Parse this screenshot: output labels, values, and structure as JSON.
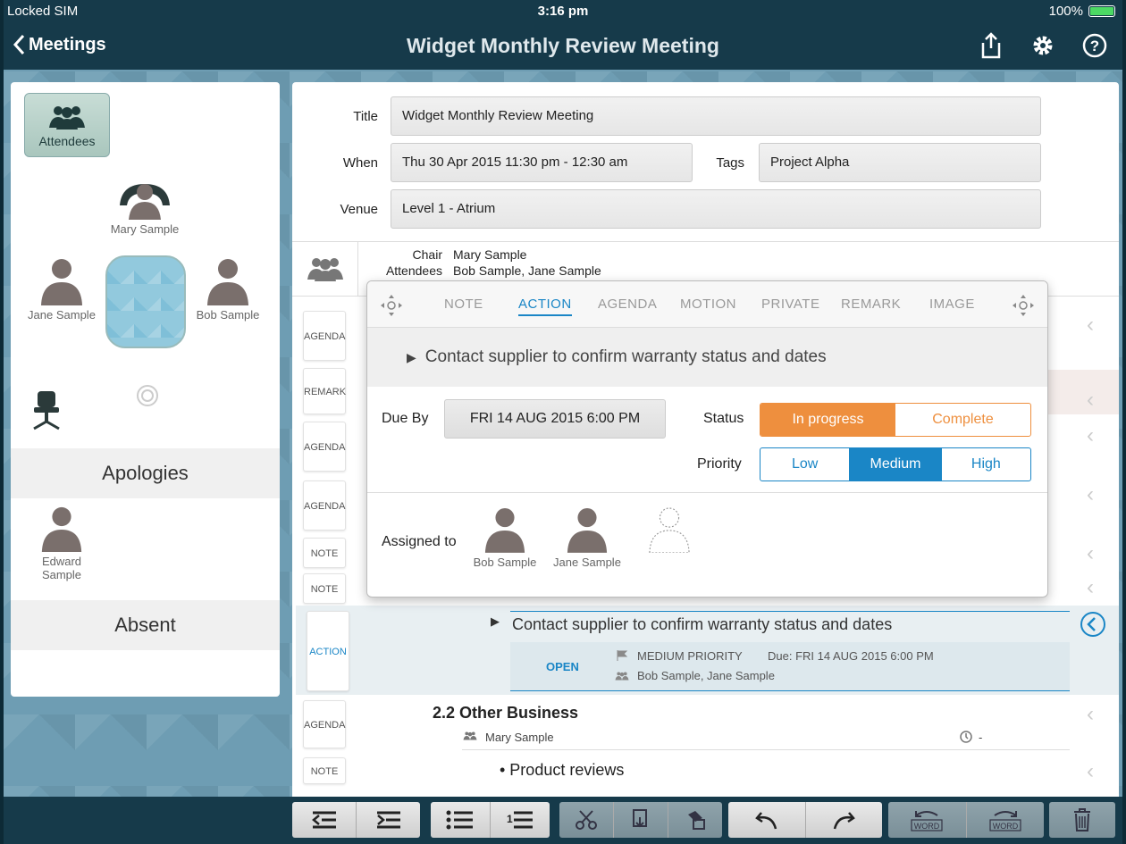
{
  "status_bar": {
    "carrier": "Locked SIM",
    "time": "3:16 pm",
    "battery": "100%"
  },
  "nav": {
    "back_label": "Meetings",
    "title": "Widget Monthly Review Meeting"
  },
  "left_panel": {
    "attendees_button": "Attendees",
    "chair": "Mary Sample",
    "left_person": "Jane Sample",
    "right_person": "Bob Sample",
    "apologies_header": "Apologies",
    "apology_person_line1": "Edward",
    "apology_person_line2": "Sample",
    "absent_header": "Absent"
  },
  "form": {
    "title_label": "Title",
    "title_value": "Widget Monthly Review Meeting",
    "when_label": "When",
    "when_value": "Thu 30 Apr 2015 11:30 pm - 12:30 am",
    "tags_label": "Tags",
    "tags_value": "Project Alpha",
    "venue_label": "Venue",
    "venue_value": "Level 1 - Atrium"
  },
  "attendee_summary": {
    "chair_label": "Chair",
    "chair_value": "Mary Sample",
    "attendees_label": "Attendees",
    "attendees_value": "Bob Sample, Jane Sample"
  },
  "side_tags": [
    "AGENDA",
    "REMARK",
    "AGENDA",
    "AGENDA",
    "NOTE",
    "NOTE"
  ],
  "popover": {
    "tabs": [
      "NOTE",
      "ACTION",
      "AGENDA",
      "MOTION",
      "PRIVATE",
      "REMARK",
      "IMAGE"
    ],
    "active_tab": "ACTION",
    "action_text": "Contact supplier to confirm warranty status and dates",
    "due_label": "Due By",
    "due_value": "FRI 14 AUG 2015 6:00 PM",
    "status_label": "Status",
    "status_options": [
      "In progress",
      "Complete"
    ],
    "priority_label": "Priority",
    "priority_options": [
      "Low",
      "Medium",
      "High"
    ],
    "assigned_label": "Assigned to",
    "assignees": [
      "Bob Sample",
      "Jane Sample"
    ]
  },
  "action_row": {
    "tag": "ACTION",
    "text": "Contact supplier to confirm warranty status and dates",
    "state": "OPEN",
    "priority": "MEDIUM PRIORITY",
    "due": "Due: FRI 14 AUG 2015 6:00 PM",
    "assignees": "Bob Sample, Jane Sample"
  },
  "agenda_row": {
    "tag": "AGENDA",
    "title": "2.2 Other Business",
    "owner": "Mary Sample",
    "duration": "-"
  },
  "note_row": {
    "tag": "NOTE",
    "text": "• Product reviews"
  },
  "colors": {
    "accent": "#1a86c6",
    "orange": "#ee8f3e",
    "navbar": "#163a4a"
  }
}
